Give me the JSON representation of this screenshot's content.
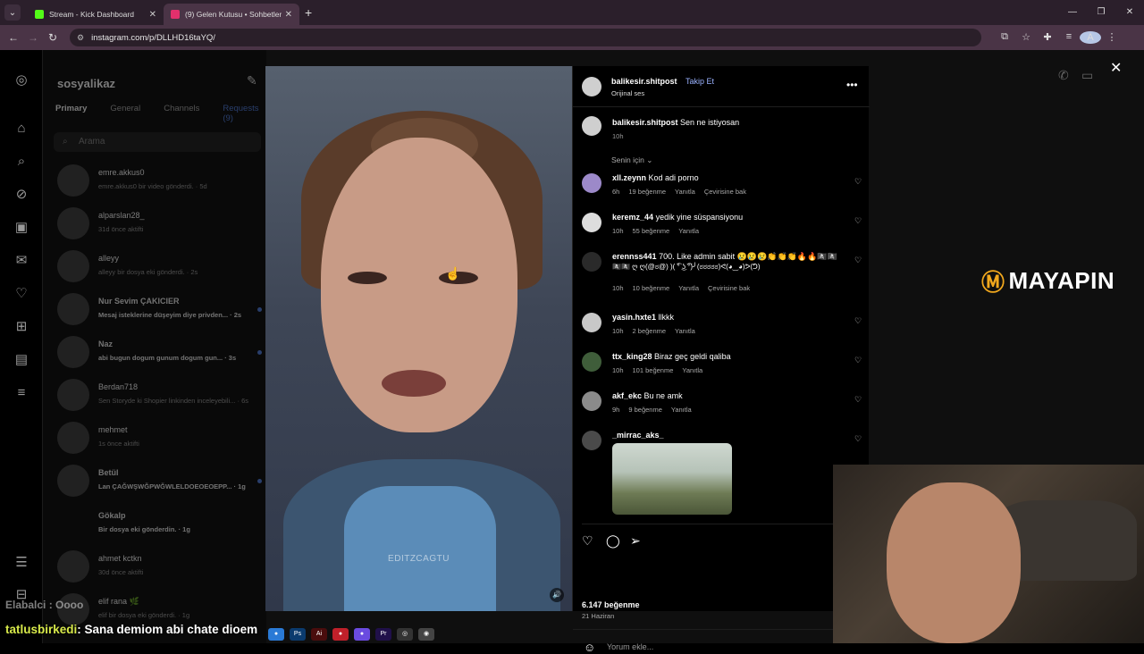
{
  "browser": {
    "tabs": [
      {
        "title": "Stream - Kick Dashboard",
        "favicon_color": "#53fc18"
      },
      {
        "title": "(9) Gelen Kutusu • Sohbetler",
        "favicon_color": "#e1306c"
      }
    ],
    "url": "instagram.com/p/DLLHD16taYQ/"
  },
  "inbox": {
    "username": "sosyalikaz",
    "tabs": [
      "Primary",
      "General",
      "Channels",
      "Requests (9)"
    ],
    "search_placeholder": "Arama",
    "chats": [
      {
        "name": "emre.akkus0",
        "sub": "emre.akkus0 bir video gönderdi. · 5d"
      },
      {
        "name": "alparslan28_",
        "sub": "31d önce aktifti"
      },
      {
        "name": "alleyy",
        "sub": "alleyy bir dosya eki gönderdi. · 2s"
      },
      {
        "name": "Nur Sevim ÇAKICIER",
        "sub": "Mesaj isteklerine düşeyim diye privden... · 2s"
      },
      {
        "name": "Naz",
        "sub": "abi bugun dogum gunum dogum gun... · 3s"
      },
      {
        "name": "Berdan718",
        "sub": "Sen Storyde ki Shopier linkinden inceleyebili... · 6s"
      },
      {
        "name": "mehmet",
        "sub": "1s önce aktifti"
      },
      {
        "name": "Betül",
        "sub": "Lan ÇAĞWŞWĞPWĞWLELDOEOEOEPP... · 1g"
      },
      {
        "name": "Gökalp",
        "sub": "Bir dosya eki gönderdin. · 1g"
      },
      {
        "name": "ahmet kctkn",
        "sub": "30d önce aktifti"
      },
      {
        "name": "elif rana 🌿",
        "sub": "elif bir dosya eki gönderdi. · 1g"
      }
    ]
  },
  "video": {
    "watermark": "EDITZCAGTU"
  },
  "post": {
    "author": "balikesir.shitpost",
    "follow": "Takip Et",
    "audio": "Orijinal ses",
    "caption": "Sen ne istiyosan",
    "caption_time": "10h",
    "sort_label": "Senin için",
    "comments": [
      {
        "user": "xll.zeynn",
        "text": "Kod adi porno",
        "time": "6h",
        "likes": "19 beğenme",
        "reply": "Yanıtla",
        "translate": "Çevirisine bak"
      },
      {
        "user": "keremz_44",
        "text": "yedik yine süspansiyonu",
        "time": "10h",
        "likes": "55 beğenme",
        "reply": "Yanıtla"
      },
      {
        "user": "erennss441",
        "text": "700. Like admin sabit 😢😢😢👏👏👏🔥🔥🏴‍☠️🏴‍☠️",
        "text2": "🏴‍☠️🏴‍☠️ ღ ღ(@ಠ@) )( ͡° ͜ʖ ͡°)╯(ಠಠಠಠಠ)ᕙ(◕‿◕)ᕗ(ᕤ)",
        "time": "10h",
        "likes": "10 beğenme",
        "reply": "Yanıtla",
        "translate": "Çevirisine bak"
      },
      {
        "user": "yasin.hxte1",
        "text": "llkkk",
        "time": "10h",
        "likes": "2 beğenme",
        "reply": "Yanıtla"
      },
      {
        "user": "ttx_king28",
        "text": "Biraz geç geldi qaliba",
        "time": "10h",
        "likes": "101 beğenme",
        "reply": "Yanıtla"
      },
      {
        "user": "akf_ekc",
        "text": "Bu ne amk",
        "time": "9h",
        "likes": "9 beğenme",
        "reply": "Yanıtla"
      },
      {
        "user": "_mirrac_aks_",
        "text": ""
      }
    ],
    "like_count": "6.147 beğenme",
    "date": "21 Haziran",
    "comment_placeholder": "Yorum ekle..."
  },
  "overlay": {
    "brand": "MAYAPIN",
    "chat_user": "tatlusbirkedi",
    "chat_msg": ": Sana demiom abi chate dioem",
    "ghost_text": "Elabalci : Oooo"
  }
}
